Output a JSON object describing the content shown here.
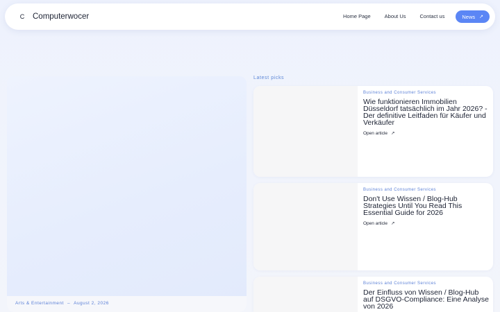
{
  "header": {
    "logo_letter": "C",
    "brand": "Computerwocer",
    "nav": {
      "home": "Home Page",
      "about": "About Us",
      "contact": "Contact us",
      "news": "News",
      "news_arrow": "↗"
    }
  },
  "hero": {
    "category": "Arts & Entertainment",
    "separator": "–",
    "date": "August 2, 2026"
  },
  "latest": {
    "label": "Latest picks",
    "items": [
      {
        "category": "Business and Consumer Services",
        "title": "Wie funktionieren Immobilien Düsseldorf tatsächlich im Jahr 2026? - Der definitive Leitfaden für Käufer und Verkäufer",
        "link": "Open article",
        "arrow": "↗"
      },
      {
        "category": "Business and Consumer Services",
        "title": "Don't Use Wissen / Blog-Hub Strategies Until You Read This Essential Guide for 2026",
        "link": "Open article",
        "arrow": "↗"
      },
      {
        "category": "Business and Consumer Services",
        "title": "Der Einfluss von Wissen / Blog-Hub auf DSGVO-Compliance: Eine Analyse von 2026",
        "link": "",
        "arrow": ""
      }
    ]
  },
  "colors": {
    "accent": "#5b86f5",
    "category": "#5a7fd6",
    "background": "#eef2fd"
  }
}
